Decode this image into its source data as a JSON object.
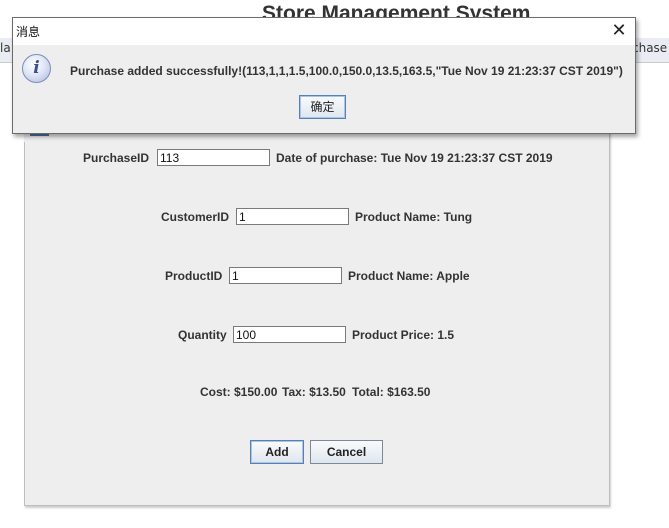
{
  "background": {
    "app_title": "Store Management System",
    "tab_left": "la",
    "tab_right": "chase"
  },
  "form": {
    "purchase_id_label": "PurchaseID",
    "purchase_id_value": "113",
    "date_label": "Date of purchase: Tue Nov 19 21:23:37 CST 2019",
    "customer_id_label": "CustomerID",
    "customer_id_value": "1",
    "customer_name_label": "Product Name: Tung",
    "product_id_label": "ProductID",
    "product_id_value": "1",
    "product_name_label": "Product Name: Apple",
    "quantity_label": "Quantity",
    "quantity_value": "100",
    "product_price_label": "Product Price: 1.5",
    "cost_label": "Cost: $150.00",
    "tax_label": "Tax: $13.50",
    "total_label": "Total: $163.50",
    "add_label": "Add",
    "cancel_label": "Cancel"
  },
  "dialog": {
    "title": "消息",
    "close_glyph": "✕",
    "icon_glyph": "i",
    "message": "Purchase added successfully!(113,1,1,1.5,100.0,150.0,13.5,163.5,\"Tue Nov 19 21:23:37 CST 2019\")",
    "ok_label": "确定"
  },
  "colors": {
    "dialog_bg": "#eeeeee",
    "titlebar_bg": "#ffffff",
    "info_icon": "#3e4f8f",
    "button_border": "#5a7fb0"
  },
  "icons": {
    "info": "info-icon",
    "close": "close-icon"
  }
}
